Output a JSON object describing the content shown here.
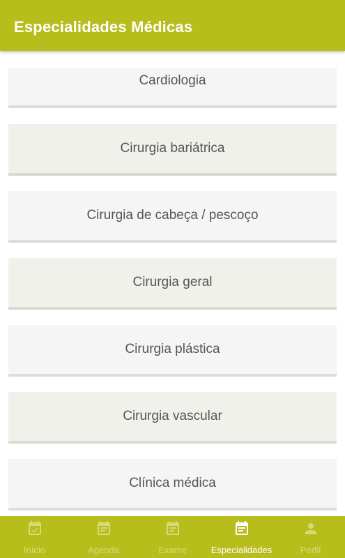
{
  "header": {
    "title": "Especialidades Médicas"
  },
  "specialties": [
    "Cardiologia",
    "Cirurgia bariátrica",
    "Cirurgia de cabeça / pescoço",
    "Cirurgia geral",
    "Cirurgia plástica",
    "Cirurgia vascular",
    "Clínica médica"
  ],
  "nav": {
    "items": [
      {
        "label": "Início",
        "icon": "calendar-check-icon",
        "active": false
      },
      {
        "label": "Agenda",
        "icon": "calendar-list-icon",
        "active": false
      },
      {
        "label": "Exame",
        "icon": "calendar-list-icon",
        "active": false
      },
      {
        "label": "Especialidades",
        "icon": "calendar-list-icon",
        "active": true
      },
      {
        "label": "Perfil",
        "icon": "person-icon",
        "active": false
      }
    ]
  },
  "colors": {
    "accent": "#b7be1c",
    "active_tab": "#ffffff",
    "inactive_tab": "#d6da7a",
    "item_text": "#555555"
  }
}
